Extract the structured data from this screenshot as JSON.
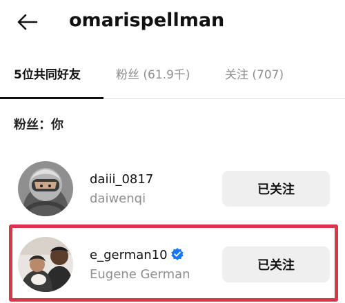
{
  "header": {
    "username": "omarispellman",
    "back_icon": "arrow-left-icon"
  },
  "tabs": [
    {
      "label": "5位共同好友",
      "active": true
    },
    {
      "label": "粉丝 (61.9千)",
      "active": false
    },
    {
      "label": "关注 (707)",
      "active": false
    }
  ],
  "section": {
    "title": "粉丝：你"
  },
  "users": [
    {
      "username": "daiii_0817",
      "fullname": "daiwenqi",
      "verified": false,
      "button_label": "已关注"
    },
    {
      "username": "e_german10",
      "fullname": "Eugene German",
      "verified": true,
      "button_label": "已关注"
    }
  ],
  "colors": {
    "highlight": "#d8374b",
    "verified": "#1877f2",
    "button_bg": "#efefef",
    "muted_text": "#8e8e8e"
  }
}
